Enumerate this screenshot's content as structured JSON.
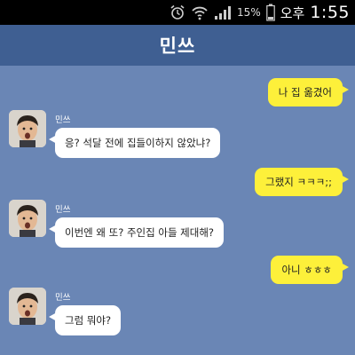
{
  "status": {
    "battery_pct": "15%",
    "ampm": "오후",
    "time": "1:55",
    "icons": [
      "alarm-icon",
      "wifi-icon",
      "signal-icon",
      "battery-icon"
    ]
  },
  "header": {
    "title": "민쓰"
  },
  "messages": [
    {
      "dir": "out",
      "text": "나 집 옮겼어"
    },
    {
      "dir": "in",
      "sender": "민쓰",
      "text": "응? 석달 전에 집들이하지 않았냐?"
    },
    {
      "dir": "out",
      "text": "그랬지 ㅋㅋㅋ;;"
    },
    {
      "dir": "in",
      "sender": "민쓰",
      "text": "이번엔 왜 또? 주인집 아들 제대해?"
    },
    {
      "dir": "out",
      "text": "아니 ㅎㅎㅎ"
    },
    {
      "dir": "in",
      "sender": "민쓰",
      "text": "그럼 뭐야?"
    }
  ],
  "colors": {
    "background": "#6a86b5",
    "header": "#3f5f92",
    "out_bubble": "#fdf03a",
    "in_bubble": "#ffffff"
  }
}
